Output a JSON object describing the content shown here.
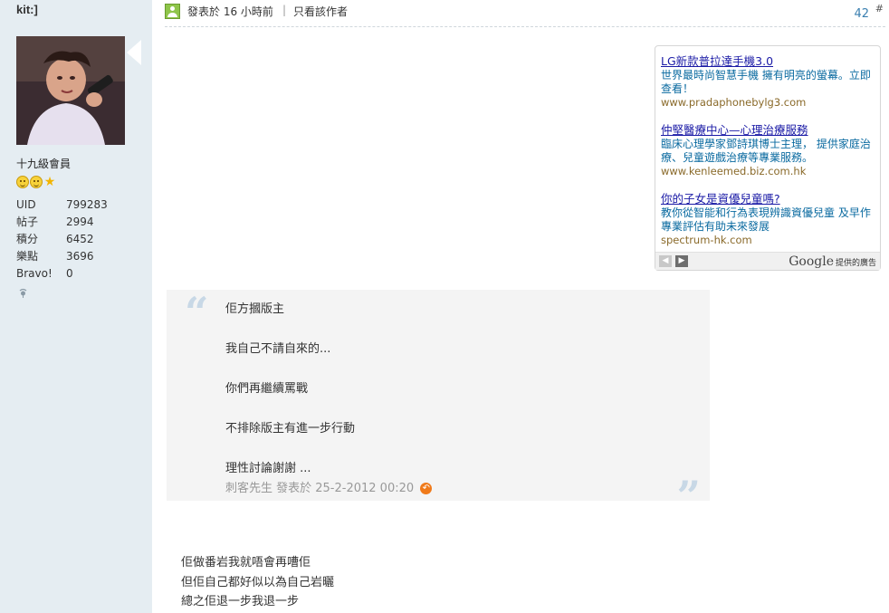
{
  "user": {
    "name": "kit:]",
    "rank": "十九級會員",
    "stats": [
      {
        "label": "UID",
        "value": "799283"
      },
      {
        "label": "帖子",
        "value": "2994"
      },
      {
        "label": "積分",
        "value": "6452"
      },
      {
        "label": "樂點",
        "value": "3696"
      },
      {
        "label": "Bravo!",
        "value": "0"
      }
    ]
  },
  "post": {
    "posted_time": "發表於 16 小時前",
    "divider": "|",
    "author_only": "只看該作者",
    "floor": "42",
    "floor_hash": "#"
  },
  "ads": {
    "items": [
      {
        "title": "LG新款普拉達手機3.0",
        "desc": "世界最時尚智慧手機 擁有明亮的螢幕。立即查看！",
        "url": "www.pradaphonebylg3.com"
      },
      {
        "title": "仲堅醫療中心—心理治療服務",
        "desc": "臨床心理學家鄧詩琪博士主理， 提供家庭治療、兒童遊戲治療等專業服務。",
        "url": "www.kenleemed.biz.com.hk"
      },
      {
        "title": "你的子女是資優兒童嗎?",
        "desc": "教你從智能和行為表現辨識資優兒童 及早作專業評估有助未來發展",
        "url": "spectrum-hk.com"
      }
    ],
    "prev": "◀",
    "next": "▶",
    "google": "Google",
    "ads_by": "提供的廣告"
  },
  "quote": {
    "open_mark": "“",
    "close_mark": "”",
    "lines": [
      "佢方摑版主",
      "我自己不請自來的...",
      "你們再繼續罵戰",
      "不排除版主有進一步行動",
      "理性討論謝謝 ..."
    ],
    "meta": "刺客先生  發表於 25-2-2012 00:20",
    "reply_icon": "↶"
  },
  "body": {
    "lines": [
      "佢做番岩我就唔會再嘈佢",
      "但佢自己都好似以為自己岩曬",
      "總之佢退一步我退一步"
    ]
  },
  "colors": {
    "sidebar_bg": "#e5edf2",
    "link_blue": "#1a1aa6",
    "floor_blue": "#3a7fb0",
    "quote_bg": "#f4f4f4"
  }
}
